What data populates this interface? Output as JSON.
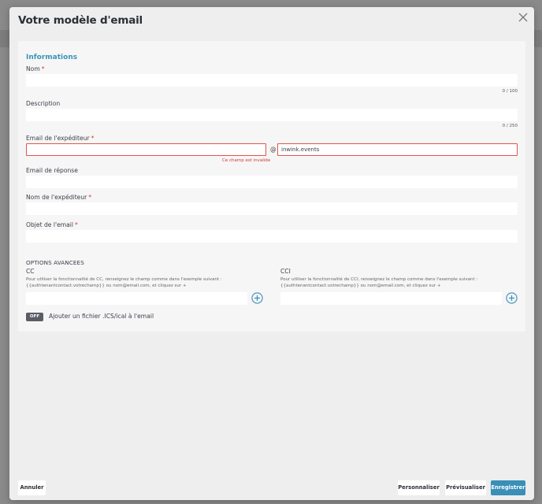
{
  "modal": {
    "title": "Votre modèle d'email"
  },
  "form": {
    "section_title": "Informations",
    "name": {
      "label": "Nom",
      "value": "",
      "counter": "0 / 100"
    },
    "description": {
      "label": "Description",
      "value": "",
      "counter": "0 / 250"
    },
    "sender_email": {
      "label": "Email de l'expéditeur",
      "local_value": "",
      "at": "@",
      "domain_value": "inwink.events",
      "error": "Ce champ est invalide"
    },
    "reply_email": {
      "label": "Email de réponse",
      "value": ""
    },
    "sender_name": {
      "label": "Nom de l'expéditeur",
      "value": ""
    },
    "subject": {
      "label": "Objet de l'email",
      "value": ""
    },
    "required_mark": "*"
  },
  "options": {
    "title": "OPTIONS AVANCEES",
    "cc": {
      "label": "CC",
      "help_line1": "Pour utiliser la fonctionnalité de CC, renseignez le champ comme dans l'exemple suivant :",
      "help_line2": "{{authtenantcontact.votrechamp}} ou nom@email.com, et cliquez sur +",
      "value": ""
    },
    "cci": {
      "label": "CCI",
      "help_line1": "Pour utiliser la fonctionnalité de CCI, renseignez le champ comme dans l'exemple suivant :",
      "help_line2": "{{authtenantcontact.votrechamp}} ou nom@email.com, et cliquez sur +",
      "value": ""
    },
    "ics_toggle": {
      "state": "OFF",
      "label": "Ajouter un fichier .ICS/ical à l'email"
    }
  },
  "footer": {
    "cancel": "Annuler",
    "customize": "Personnaliser",
    "preview": "Prévisualiser",
    "save": "Enregistrer"
  },
  "colors": {
    "accent": "#3a8fb7",
    "error": "#d9342b",
    "toggle_off": "#5a5e64"
  }
}
